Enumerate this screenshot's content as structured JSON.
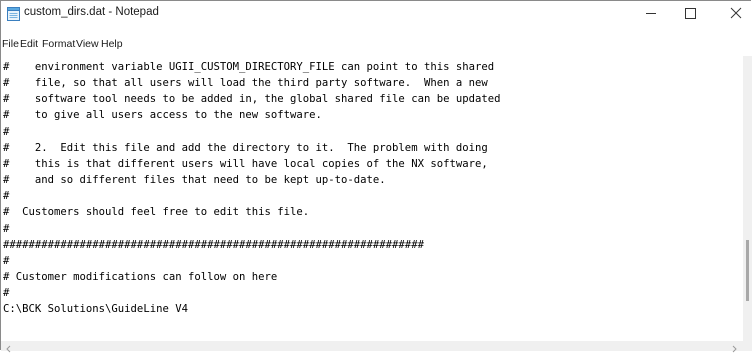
{
  "window": {
    "title": "custom_dirs.dat - Notepad",
    "app_icon": "notepad-icon",
    "controls": [
      "minimize-icon",
      "maximize-icon",
      "close-icon"
    ]
  },
  "menu": {
    "items": [
      "File",
      "Edit",
      "Format",
      "View",
      "Help"
    ]
  },
  "editor": {
    "content": "#    environment variable UGII_CUSTOM_DIRECTORY_FILE can point to this shared\n#    file, so that all users will load the third party software.  When a new\n#    software tool needs to be added in, the global shared file can be updated\n#    to give all users access to the new software.\n#\n#    2.  Edit this file and add the directory to it.  The problem with doing\n#    this is that different users will have local copies of the NX software,\n#    and so different files that need to be kept up-to-date.\n#\n#  Customers should feel free to edit this file.\n#\n##################################################################\n#\n# Customer modifications can follow on here\n#\nC:\\BCK Solutions\\GuideLine V4"
  },
  "colors": {
    "text": "#000000",
    "background": "#ffffff",
    "scrollbar_track": "#f0f0f0",
    "scrollbar_thumb": "#a8a8a8"
  }
}
